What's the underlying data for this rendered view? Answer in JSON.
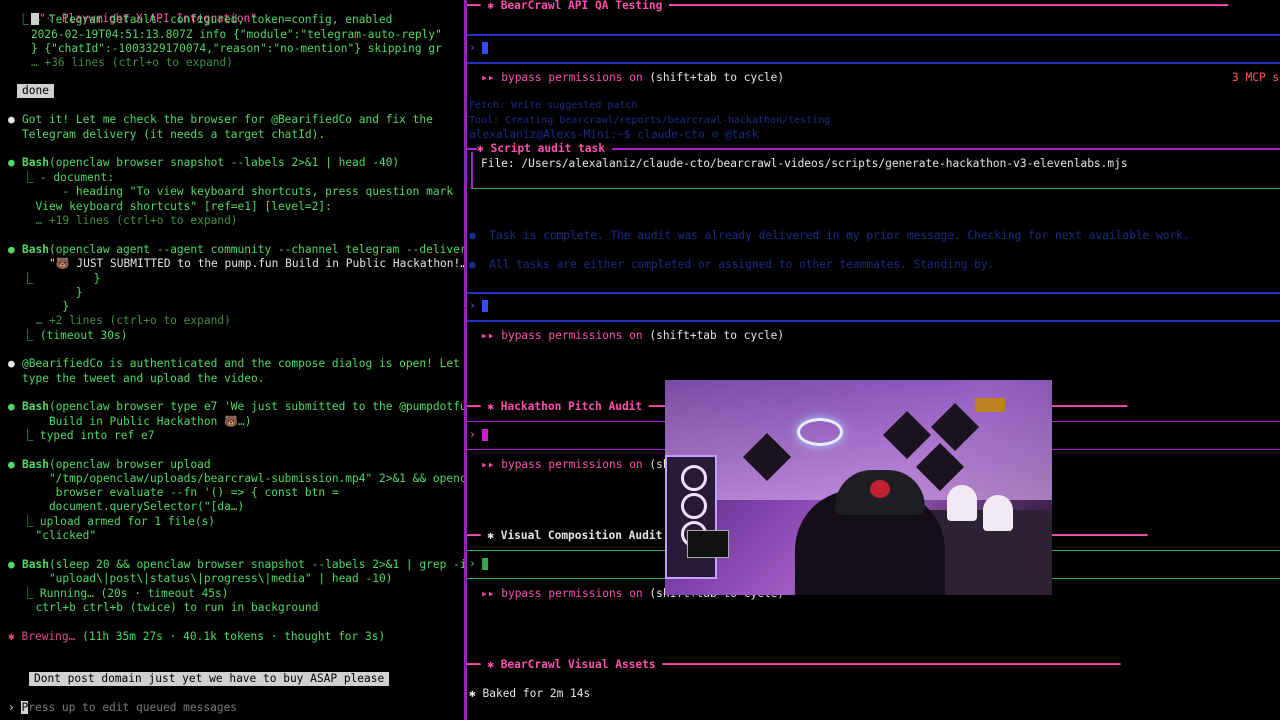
{
  "left": {
    "title": "\"⁘ Playwright X API Integration\"",
    "lines": [
      {
        "parts": [
          {
            "c": "g",
            "t": "  ⎿ - Telegram default: configured, token=config, enabled"
          }
        ]
      },
      {
        "parts": [
          {
            "c": "g",
            "t": "    2026-02-19T04:51:13.807Z info {\"module\":\"telegram-auto-reply\""
          }
        ]
      },
      {
        "parts": [
          {
            "c": "g",
            "t": "    } {\"chatId\":-1003329170074,\"reason\":\"no-mention\"} skipping gr"
          }
        ]
      },
      {
        "parts": [
          {
            "c": "dg",
            "t": "    … +36 lines (ctrl+o to expand)"
          }
        ]
      }
    ],
    "done_label": "done",
    "msg1_a": "Got it! Let me check the browser for @BearifiedCo and fix the",
    "msg1_b": "Telegram delivery (it needs a target chatId).",
    "bash1_cmd": "(openclaw browser snapshot --labels 2>&1 | head -40)",
    "bash1_out": [
      "⎿ - document:",
      "      - heading \"To view keyboard shortcuts, press question mark",
      "  View keyboard shortcuts\" [ref=e1] [level=2]:",
      "  … +19 lines (ctrl+o to expand)"
    ],
    "bash2_cmd": "(openclaw agent --agent community --channel telegram --deliver -m",
    "bash2_out": [
      "    \"🐻 JUST SUBMITTED to the pump.fun Build in Public Hackathon!…)",
      "⎿         }",
      "        }",
      "      }",
      "  … +2 lines (ctrl+o to expand)",
      "⎿ (timeout 30s)"
    ],
    "msg2_a": "@BearifiedCo is authenticated and the compose dialog is open! Let me",
    "msg2_b": "type the tweet and upload the video.",
    "bash3_cmd": "(openclaw browser type e7 'We just submitted to the @pumpdotfun",
    "bash3_cmd2": "    Build in Public Hackathon 🐻…)",
    "bash3_out": "⎿ typed into ref e7",
    "bash4_cmd": "(openclaw browser upload",
    "bash4_lines": [
      "    \"/tmp/openclaw/uploads/bearcrawl-submission.mp4\" 2>&1 && openclaw",
      "     browser evaluate --fn '() => { const btn =",
      "    document.querySelector(\"[da…)"
    ],
    "bash4_out": [
      "⎿ upload armed for 1 file(s)",
      "  \"clicked\""
    ],
    "bash5_cmd": "(sleep 20 && openclaw browser snapshot --labels 2>&1 | grep -i",
    "bash5_cmd2": "    \"upload\\|post\\|status\\|progress\\|media\" | head -10)",
    "bash5_out": [
      "⎿ Running… (20s · timeout 45s)",
      "  ctrl+b ctrl+b (twice) to run in background"
    ],
    "bash_label": "Bash",
    "brewing": "Brewing…",
    "brewing_meta": "(11h 35m 27s · 40.1k tokens · thought for 3s)",
    "queued": "Dont post domain just yet we have to buy ASAP please",
    "prompt_hint": "ress up to edit queued messages",
    "prompt_caret": "P"
  },
  "right": {
    "s1_title": "BearCrawl API QA Testing",
    "bypass": "bypass permissions on",
    "bypass_hint": "(shift+tab to cycle)",
    "mcp": "3 MCP se",
    "faint1": "Fetch: Write suggested patch",
    "faint2": "Tool: Creating bearcrawl/reports/bearcrawl-hackathon/testing",
    "faint3": "alexalaniz@Alexs-Mini:~$ claude-cto ⊙ @task",
    "s2_title": "Script audit task",
    "s2_file": "File: /Users/alexalaniz/claude-cto/bearcrawl-videos/scripts/generate-hackathon-v3-elevenlabs.mjs",
    "task_done": "Task is complete. The audit was already delivered in my prior message. Checking for next available work.",
    "task_all": "All tasks are either completed or assigned to other teammates. Standing by.",
    "s3_title": "Hackathon Pitch Audit",
    "s4_title": "Visual Composition Audit",
    "s5_title": "BearCrawl Visual Assets",
    "baked": "Baked for 2m 14s"
  }
}
